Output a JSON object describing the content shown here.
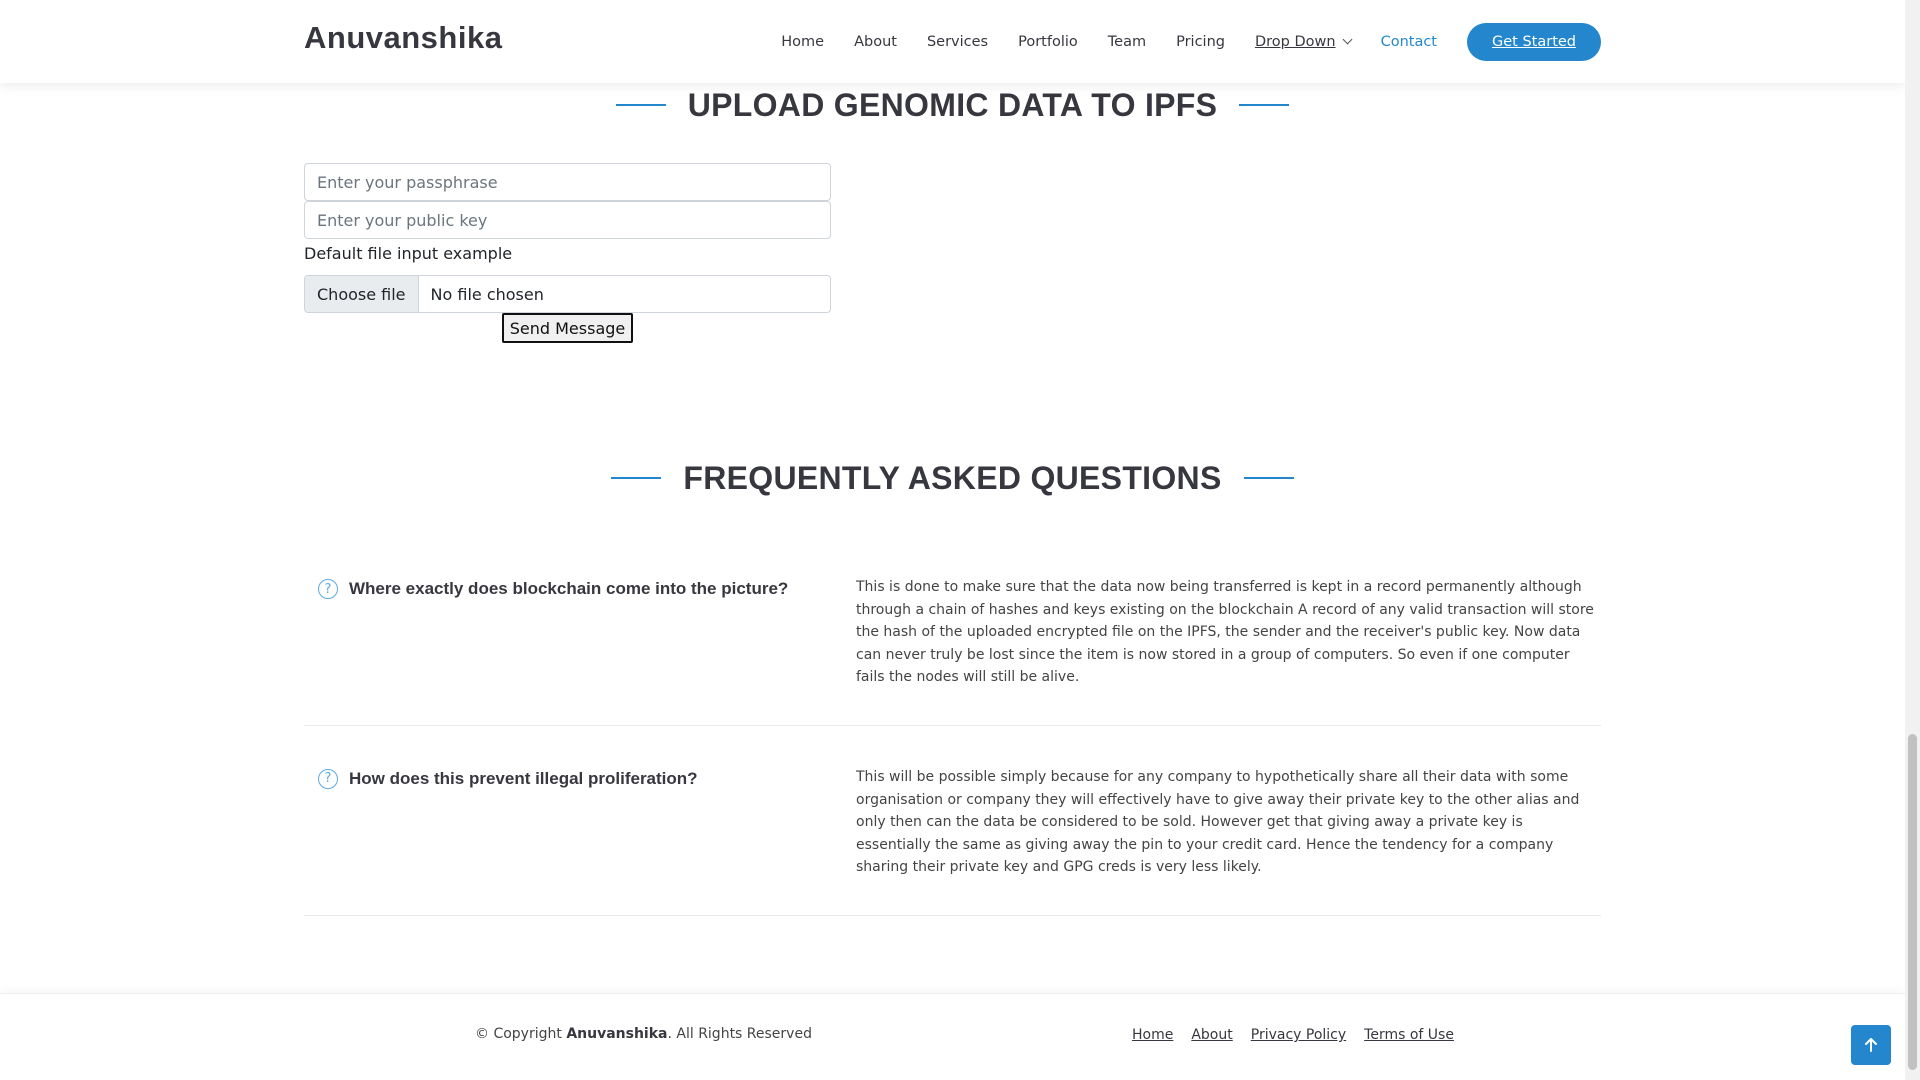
{
  "header": {
    "logo": "Anuvanshika",
    "nav": [
      {
        "label": "Home"
      },
      {
        "label": "About"
      },
      {
        "label": "Services"
      },
      {
        "label": "Portfolio"
      },
      {
        "label": "Team"
      },
      {
        "label": "Pricing"
      },
      {
        "label": "Drop Down"
      },
      {
        "label": "Contact"
      }
    ],
    "cta_label": "Get Started"
  },
  "upload": {
    "title": "UPLOAD GENOMIC DATA TO IPFS",
    "passphrase_placeholder": "Enter your passphrase",
    "public_key_placeholder": "Enter your public key",
    "file_label": "Default file input example",
    "file_button": "Choose file",
    "file_status": "No file chosen",
    "submit_label": "Send Message"
  },
  "faq": {
    "title": "FREQUENTLY ASKED QUESTIONS",
    "items": [
      {
        "question": "Where exactly does blockchain come into the picture?",
        "answer": "This is done to make sure that the data now being transferred is kept in a record permanently although through a chain of hashes and keys existing on the blockchain A record of any valid transaction will store the hash of the uploaded encrypted file on the IPFS, the sender and the receiver's public key. Now data can never truly be lost since the item is now stored in a group of computers. So even if one computer fails the nodes will still be alive."
      },
      {
        "question": "How does this prevent illegal proliferation?",
        "answer": "This will be possible simply because for any company to hypothetically share all their data with some organisation or company they will effectively have to give away their private key to the other alias and only then can the data be considered to be sold. However get that giving away a private key is essentially the same as giving away the pin to your credit card. Hence the tendency for a company sharing their private key and GPG creds is very less likely."
      }
    ]
  },
  "footer": {
    "copyright_prefix": "© Copyright",
    "brand": "Anuvanshika",
    "copyright_suffix": ". All Rights Reserved",
    "links": [
      {
        "label": "Home"
      },
      {
        "label": "About"
      },
      {
        "label": "Privacy Policy"
      },
      {
        "label": "Terms of Use"
      }
    ]
  },
  "icons": {
    "faq_icon": "question-circle-icon",
    "back_to_top": "arrow-up-icon",
    "dropdown": "chevron-down-icon"
  },
  "colors": {
    "accent": "#2487ce",
    "heading": "#37373f",
    "text": "#444444"
  }
}
